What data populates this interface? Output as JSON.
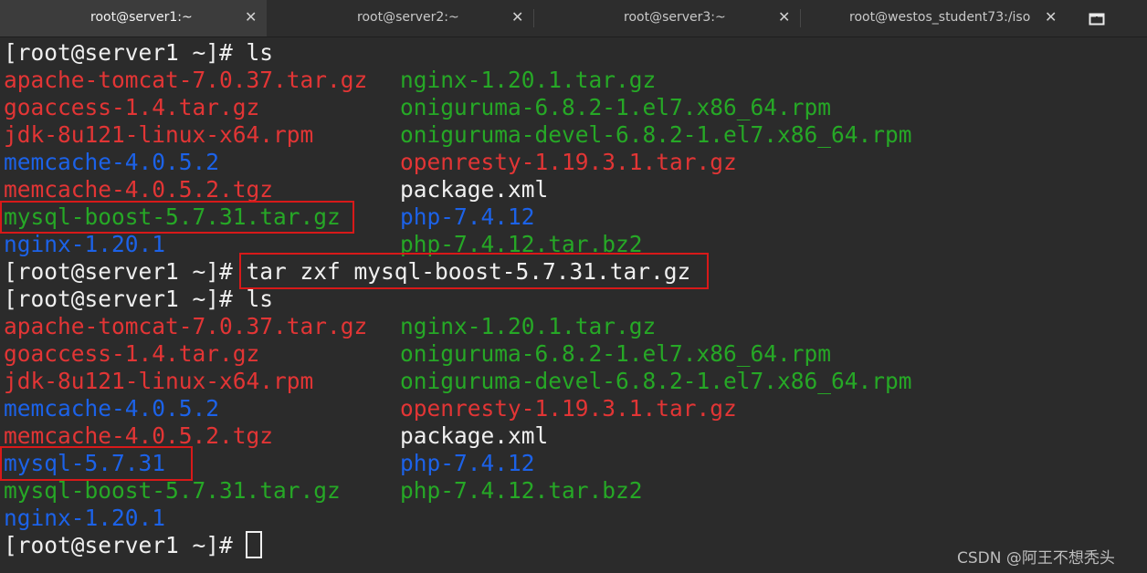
{
  "tabs": [
    {
      "label": "root@server1:~",
      "close": "✕",
      "active": true
    },
    {
      "label": "root@server2:~",
      "close": "✕",
      "active": false
    },
    {
      "label": "root@server3:~",
      "close": "✕",
      "active": false
    },
    {
      "label": "root@westos_student73:/iso",
      "close": "✕",
      "active": false
    }
  ],
  "new_tab_icon": "new-tab-icon",
  "terminal": {
    "lines": [
      {
        "prompt": "[root@server1 ~]# ",
        "cmd": "ls"
      },
      {
        "col1": "apache-tomcat-7.0.37.tar.gz",
        "col2": "nginx-1.20.1.tar.gz"
      },
      {
        "col1": "goaccess-1.4.tar.gz",
        "col2": "oniguruma-6.8.2-1.el7.x86_64.rpm"
      },
      {
        "col1": "jdk-8u121-linux-x64.rpm",
        "col2": "oniguruma-devel-6.8.2-1.el7.x86_64.rpm"
      },
      {
        "col1": "memcache-4.0.5.2",
        "col2": "openresty-1.19.3.1.tar.gz"
      },
      {
        "col1": "memcache-4.0.5.2.tgz",
        "col2": "package.xml"
      },
      {
        "col1": "mysql-boost-5.7.31.tar.gz",
        "col2": "php-7.4.12"
      },
      {
        "col1": "nginx-1.20.1",
        "col2": "php-7.4.12.tar.bz2"
      },
      {
        "prompt": "[root@server1 ~]# ",
        "cmd": "tar zxf mysql-boost-5.7.31.tar.gz"
      },
      {
        "prompt": "[root@server1 ~]# ",
        "cmd": "ls"
      },
      {
        "col1": "apache-tomcat-7.0.37.tar.gz",
        "col2": "nginx-1.20.1.tar.gz"
      },
      {
        "col1": "goaccess-1.4.tar.gz",
        "col2": "oniguruma-6.8.2-1.el7.x86_64.rpm"
      },
      {
        "col1": "jdk-8u121-linux-x64.rpm",
        "col2": "oniguruma-devel-6.8.2-1.el7.x86_64.rpm"
      },
      {
        "col1": "memcache-4.0.5.2",
        "col2": "openresty-1.19.3.1.tar.gz"
      },
      {
        "col1": "memcache-4.0.5.2.tgz",
        "col2": "package.xml"
      },
      {
        "col1": "mysql-5.7.31",
        "col2": "php-7.4.12"
      },
      {
        "col1": "mysql-boost-5.7.31.tar.gz",
        "col2": "php-7.4.12.tar.bz2"
      },
      {
        "col1": "nginx-1.20.1"
      },
      {
        "prompt": "[root@server1 ~]# ",
        "cmd": ""
      }
    ]
  },
  "colors": {
    "archive": "#e23535",
    "package": "#26a826",
    "directory": "#1c62e8",
    "plain": "#efefef",
    "highlight_box": "#d81919"
  },
  "watermark": "CSDN @阿王不想秃头"
}
